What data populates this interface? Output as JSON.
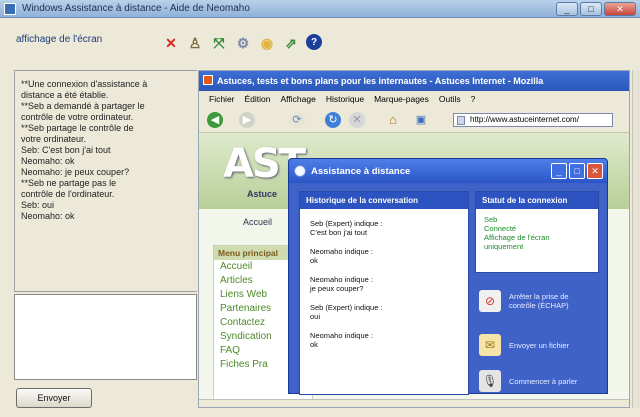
{
  "window": {
    "title": "Windows Assistance à distance - Aide de Neomaho",
    "minimize": "_",
    "maximize": "□",
    "close": "✕"
  },
  "toolbar": {
    "screen_label": "affichage de l'écran",
    "icons": [
      "close-x-icon",
      "person-icon",
      "fit-screen-icon",
      "gear-icon",
      "chat-bubble-icon",
      "send-file-icon",
      "help-icon"
    ]
  },
  "chat": {
    "lines": [
      "**Une connexion d'assistance à",
      "distance a été établie.",
      "**Seb a demandé à partager le",
      "contrôle de votre ordinateur.",
      "**Seb partage le contrôle de",
      "votre ordinateur.",
      "Seb: C'est bon j'ai tout",
      "Neomaho: ok",
      "Neomaho: je peux couper?",
      "**Seb ne partage pas le",
      "contrôle de l'ordinateur.",
      "Seb: oui",
      "Neomaho: ok"
    ],
    "input_value": "",
    "send_label": "Envoyer"
  },
  "browser": {
    "title": "Astuces, tests et bons plans pour les internautes - Astuces Internet - Mozilla",
    "menu": [
      "Fichier",
      "Édition",
      "Affichage",
      "Historique",
      "Marque-pages",
      "Outils",
      "?"
    ],
    "address": "http://www.astuceinternet.com/",
    "site": {
      "logo": "AST",
      "sub": "Astuce",
      "nav": "Accueil",
      "menu_header": "Menu principal",
      "menu_items": [
        "Accueil",
        "Articles",
        "Liens Web",
        "Partenaires",
        "Contactez",
        "Syndication",
        "FAQ",
        "Fiches Pra"
      ]
    }
  },
  "dialog": {
    "title": "Assistance à distance",
    "history_header": "Historique de la conversation",
    "history": [
      {
        "who": "Seb (Expert) indique :",
        "text": "C'est bon j'ai tout"
      },
      {
        "who": "Neomaho indique :",
        "text": "ok"
      },
      {
        "who": "Neomaho indique :",
        "text": "je peux couper?"
      },
      {
        "who": "Seb (Expert) indique :",
        "text": "oui"
      },
      {
        "who": "Neomaho indique :",
        "text": "ok"
      }
    ],
    "status_header": "Statut de la connexion",
    "status_lines": [
      "Seb",
      "Connecté",
      "Affichage de l'écran",
      "uniquement"
    ],
    "actions": [
      {
        "label_1": "Arrêter la prise de",
        "label_2": "contrôle (ÉCHAP)",
        "icon": "stop-control-icon"
      },
      {
        "label_1": "Envoyer un fichier",
        "label_2": "",
        "icon": "send-file-icon"
      },
      {
        "label_1": "Commencer à parler",
        "label_2": "",
        "icon": "talk-icon"
      }
    ]
  }
}
